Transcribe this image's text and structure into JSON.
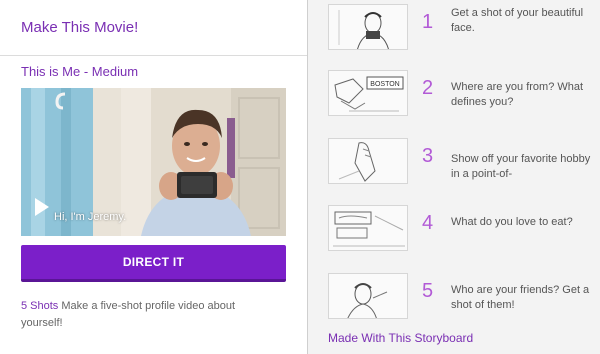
{
  "header": {
    "title": "Make This Movie!"
  },
  "video": {
    "title": "This is Me - Medium",
    "caption": "Hi, I'm Jeremy."
  },
  "cta": {
    "label": "DIRECT IT"
  },
  "description": {
    "shots_label": "5 Shots",
    "text": " Make a five-shot profile video about yourself!"
  },
  "shots": [
    {
      "number": "1",
      "text": "Get a shot of your beautiful face."
    },
    {
      "number": "2",
      "text": "Where are you from? What defines you?",
      "sign": "BOSTON"
    },
    {
      "number": "3",
      "text": "Show off your favorite hobby in a point-of-"
    },
    {
      "number": "4",
      "text": "What do you love to eat?"
    },
    {
      "number": "5",
      "text": "Who are your friends? Get a shot of them!"
    }
  ],
  "footer": {
    "made_with": "Made With This Storyboard"
  },
  "colors": {
    "accent": "#7a2fb3",
    "button": "#7b1fc9",
    "number": "#b25ad6"
  }
}
